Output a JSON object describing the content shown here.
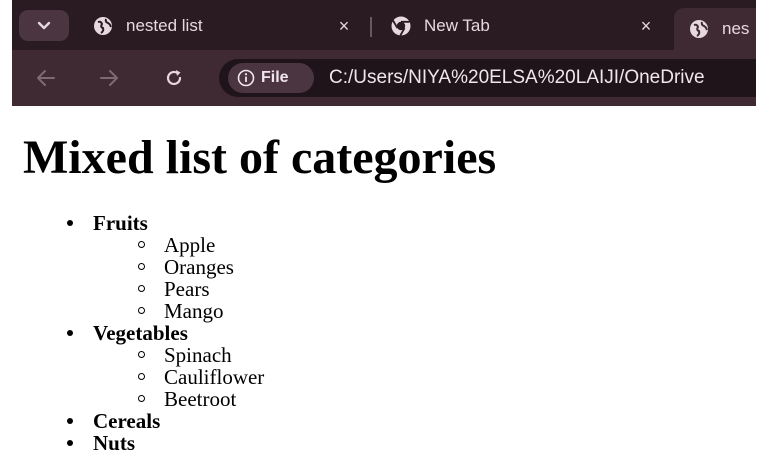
{
  "browser": {
    "tabs": [
      {
        "title": "nested list",
        "icon": "globe-icon",
        "close": "×"
      },
      {
        "title": "New Tab",
        "icon": "chrome-icon",
        "close": "×"
      },
      {
        "title": "nes",
        "icon": "globe-icon"
      }
    ],
    "site_chip_label": "File",
    "url": "C:/Users/NIYA%20ELSA%20LAIJI/OneDrive"
  },
  "page": {
    "heading": "Mixed list of categories",
    "categories": [
      {
        "label": "Fruits",
        "items": [
          "Apple",
          "Oranges",
          "Pears",
          "Mango"
        ]
      },
      {
        "label": "Vegetables",
        "items": [
          "Spinach",
          "Cauliflower",
          "Beetroot"
        ]
      },
      {
        "label": "Cereals",
        "items": []
      },
      {
        "label": "Nuts",
        "items": []
      }
    ]
  },
  "colors": {
    "tabstrip": "#2a1b22",
    "toolbar": "#3f2a34",
    "omnibox": "#1f1419",
    "text_light": "#e7d8df"
  }
}
